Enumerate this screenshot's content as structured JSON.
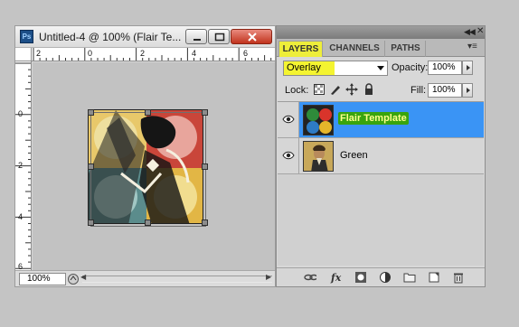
{
  "document": {
    "app_badge": "Ps",
    "title": "Untitled-4 @ 100% (Flair Te...",
    "ruler_top_labels": [
      "2",
      "0",
      "2",
      "4",
      "6"
    ],
    "ruler_left_labels": [
      "0",
      "2",
      "4",
      "6"
    ],
    "zoom": "100%"
  },
  "panel": {
    "tabs": [
      "LAYERS",
      "CHANNELS",
      "PATHS"
    ],
    "active_tab": "LAYERS",
    "blend_mode": "Overlay",
    "opacity_label": "Opacity:",
    "opacity_value": "100%",
    "lock_label": "Lock:",
    "fill_label": "Fill:",
    "fill_value": "100%",
    "layers": [
      {
        "name": "Flair Template",
        "selected": true,
        "visible": true
      },
      {
        "name": "Green",
        "selected": false,
        "visible": true
      }
    ]
  },
  "colors": {
    "selection_blue": "#3a94f5",
    "highlight_yellow": "#f4f430",
    "highlight_green": "#39a40d",
    "close_red": "#c1331d"
  },
  "icons": [
    "ps-app-icon",
    "minimize-icon",
    "maximize-icon",
    "close-icon",
    "eye-icon",
    "link-icon",
    "fx-icon",
    "mask-icon",
    "adjustment-icon",
    "folder-icon",
    "new-layer-icon",
    "trash-icon",
    "lock-transparency-icon",
    "lock-brush-icon",
    "lock-move-icon",
    "lock-all-icon"
  ]
}
